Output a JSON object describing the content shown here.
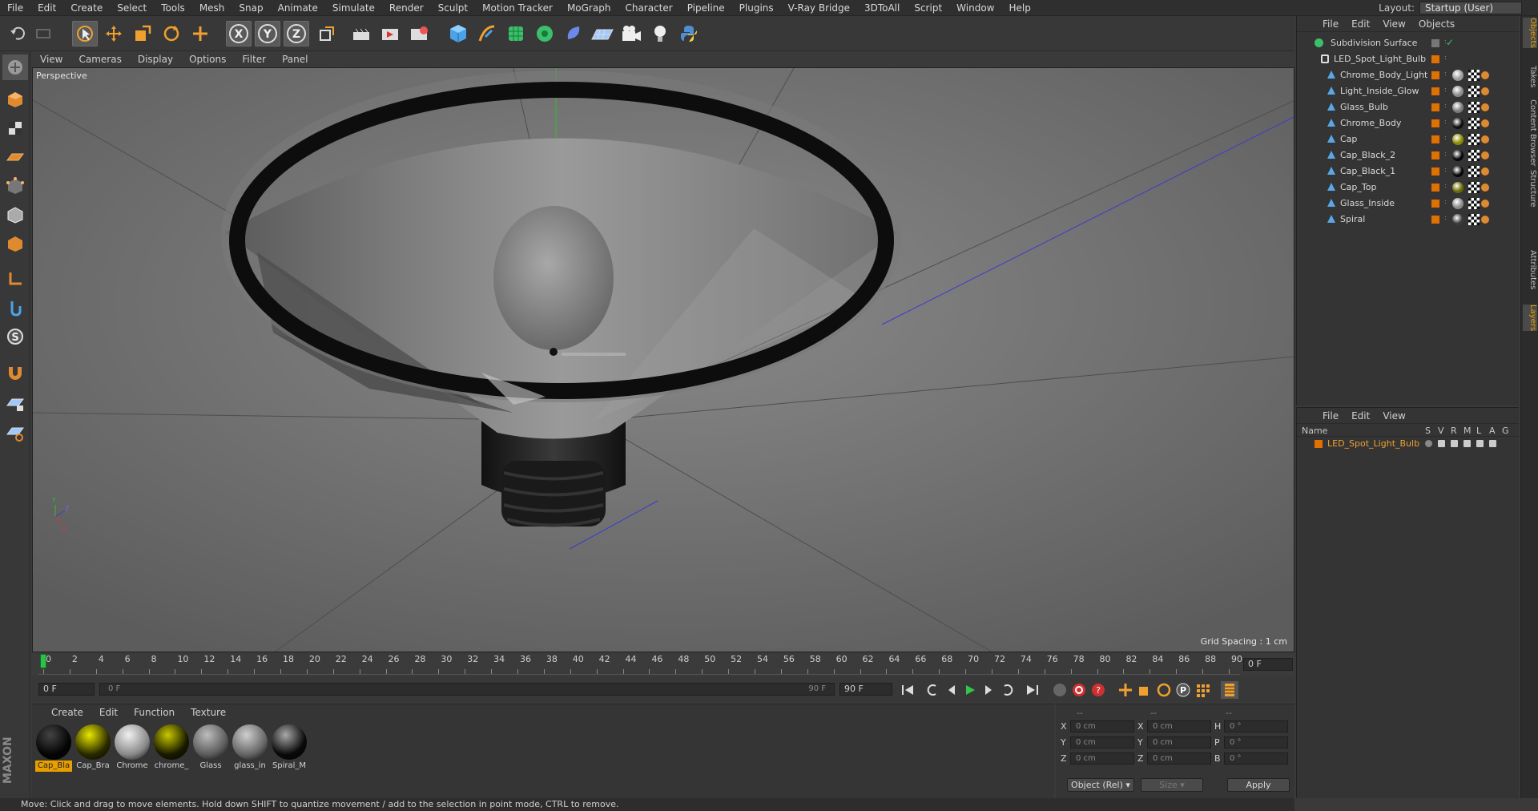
{
  "menu": [
    "File",
    "Edit",
    "Create",
    "Select",
    "Tools",
    "Mesh",
    "Snap",
    "Animate",
    "Simulate",
    "Render",
    "Sculpt",
    "Motion Tracker",
    "MoGraph",
    "Character",
    "Pipeline",
    "Plugins",
    "V-Ray Bridge",
    "3DToAll",
    "Script",
    "Window",
    "Help"
  ],
  "layout": {
    "label": "Layout:",
    "value": "Startup (User)"
  },
  "toolbar_icons": [
    "undo-icon",
    "redo-icon",
    "live-selection-icon",
    "move-icon",
    "scale-icon",
    "rotate-icon",
    "last-tool-icon",
    "x-axis-icon",
    "y-axis-icon",
    "z-axis-icon",
    "coordinate-system-icon",
    "render-view-icon",
    "render-picture-viewer-icon",
    "edit-render-settings-icon",
    "cube-icon",
    "pen-icon",
    "subdivision-icon",
    "array-icon",
    "deformer-icon",
    "floor-icon",
    "camera-icon",
    "light-icon",
    "python-icon"
  ],
  "viewport": {
    "menu": [
      "View",
      "Cameras",
      "Display",
      "Options",
      "Filter",
      "Panel"
    ],
    "label": "Perspective",
    "grid_spacing": "Grid Spacing : 1 cm"
  },
  "timeline": {
    "ticks": [
      "0",
      "2",
      "4",
      "6",
      "8",
      "10",
      "12",
      "14",
      "16",
      "18",
      "20",
      "22",
      "24",
      "26",
      "28",
      "30",
      "32",
      "34",
      "36",
      "38",
      "40",
      "42",
      "44",
      "46",
      "48",
      "50",
      "52",
      "54",
      "56",
      "58",
      "60",
      "62",
      "64",
      "66",
      "68",
      "70",
      "72",
      "74",
      "76",
      "78",
      "80",
      "82",
      "84",
      "86",
      "88",
      "90"
    ],
    "current_frame": "0 F"
  },
  "playbar": {
    "start": "0 F",
    "range_start": "0 F",
    "range_end": "90 F",
    "end": "90 F"
  },
  "materials": {
    "menu": [
      "Create",
      "Edit",
      "Function",
      "Texture"
    ],
    "items": [
      {
        "label": "Cap_Bla",
        "color": "#050505",
        "highlight": "#444",
        "selected": true
      },
      {
        "label": "Cap_Bra",
        "color": "#2a2a00",
        "highlight": "#e8e800",
        "selected": false
      },
      {
        "label": "Chrome",
        "color": "#8a8a8a",
        "highlight": "#f0f0f0",
        "selected": false
      },
      {
        "label": "chrome_",
        "color": "#1a1a00",
        "highlight": "#c8c800",
        "selected": false
      },
      {
        "label": "Glass",
        "color": "#5c5c5c",
        "highlight": "#bdbdbd",
        "selected": false
      },
      {
        "label": "glass_in",
        "color": "#666",
        "highlight": "#cfcfcf",
        "selected": false
      },
      {
        "label": "Spiral_M",
        "color": "#0a0a0a",
        "highlight": "#a8a8a8",
        "selected": false
      }
    ]
  },
  "coords": {
    "header": [
      "--",
      "--",
      "--"
    ],
    "rows": [
      {
        "a": "X",
        "av": "0 cm",
        "b": "X",
        "bv": "0 cm",
        "c": "H",
        "cv": "0 °"
      },
      {
        "a": "Y",
        "av": "0 cm",
        "b": "Y",
        "bv": "0 cm",
        "c": "P",
        "cv": "0 °"
      },
      {
        "a": "Z",
        "av": "0 cm",
        "b": "Z",
        "bv": "0 cm",
        "c": "B",
        "cv": "0 °"
      }
    ],
    "mode": "Object (Rel)",
    "size": "Size",
    "apply": "Apply"
  },
  "status": "Move: Click and drag to move elements. Hold down SHIFT to quantize movement / add to the selection in point mode, CTRL to remove.",
  "objects": {
    "menu": [
      "File",
      "Edit",
      "View",
      "Objects"
    ],
    "rows": [
      {
        "name": "Subdivision Surface",
        "indent": 0,
        "icon": "subdivision-icon",
        "tags": false
      },
      {
        "name": "LED_Spot_Light_Bulb",
        "indent": 1,
        "icon": "null-icon",
        "tags": false
      },
      {
        "name": "Chrome_Body_Light",
        "indent": 2,
        "icon": "polygon-icon",
        "tags": true,
        "mat": "#9a9a9a"
      },
      {
        "name": "Light_Inside_Glow",
        "indent": 2,
        "icon": "polygon-icon",
        "tags": true,
        "mat": "#8a8a8a"
      },
      {
        "name": "Glass_Bulb",
        "indent": 2,
        "icon": "polygon-icon",
        "tags": true,
        "mat": "#7a7a7a"
      },
      {
        "name": "Chrome_Body",
        "indent": 2,
        "icon": "polygon-icon",
        "tags": true,
        "mat": "#0d0d0d"
      },
      {
        "name": "Cap",
        "indent": 2,
        "icon": "polygon-icon",
        "tags": true,
        "mat": "#8a8a00"
      },
      {
        "name": "Cap_Black_2",
        "indent": 2,
        "icon": "polygon-icon",
        "tags": true,
        "mat": "#050505"
      },
      {
        "name": "Cap_Black_1",
        "indent": 2,
        "icon": "polygon-icon",
        "tags": true,
        "mat": "#050505"
      },
      {
        "name": "Cap_Top",
        "indent": 2,
        "icon": "polygon-icon",
        "tags": true,
        "mat": "#6a6a00"
      },
      {
        "name": "Glass_Inside",
        "indent": 2,
        "icon": "polygon-icon",
        "tags": true,
        "mat": "#8a8a8a"
      },
      {
        "name": "Spiral",
        "indent": 2,
        "icon": "polygon-icon",
        "tags": true,
        "mat": "#3a3a3a"
      }
    ]
  },
  "layers": {
    "menu": [
      "File",
      "Edit",
      "View"
    ],
    "columns": [
      "Name",
      "S",
      "V",
      "R",
      "M",
      "L",
      "A",
      "G"
    ],
    "rows": [
      {
        "name": "LED_Spot_Light_Bulb"
      }
    ]
  },
  "side_tabs": [
    "Objects",
    "Takes",
    "Content Browser",
    "Structure",
    "Attributes",
    "Layers"
  ],
  "colors": {
    "accent": "#e8a000",
    "layer": "#e07000",
    "selection": "#5aa7e8"
  }
}
